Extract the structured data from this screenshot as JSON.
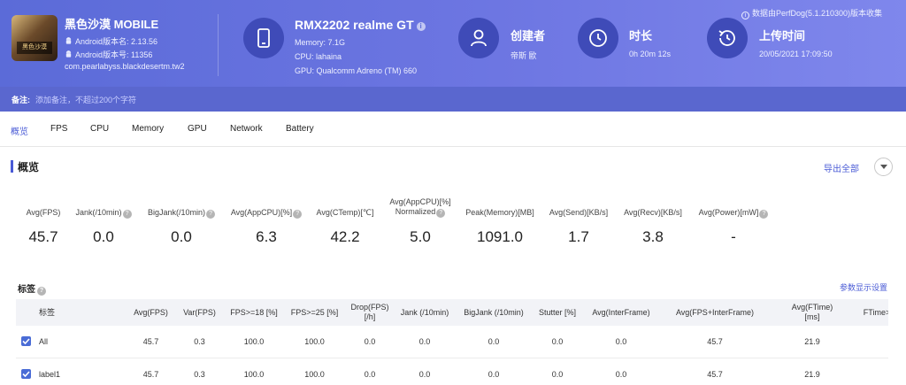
{
  "app": {
    "name": "黑色沙漠 MOBILE",
    "version_name": "Android版本名: 2.13.56",
    "version_code": "Android版本号: 11356",
    "package": "com.pearlabyss.blackdesertm.tw2",
    "icon_text": "黑色沙漠"
  },
  "device": {
    "model": "RMX2202 realme GT",
    "memory": "Memory: 7.1G",
    "cpu": "CPU: lahaina",
    "gpu": "GPU: Qualcomm Adreno (TM) 660"
  },
  "creator": {
    "title": "创建者",
    "value": "帝斯 歐"
  },
  "duration": {
    "title": "时长",
    "value": "0h 20m 12s"
  },
  "upload": {
    "title": "上传时间",
    "value": "20/05/2021 17:09:50"
  },
  "perfdog_note": "数据由PerfDog(5.1.210300)版本收集",
  "note": {
    "label": "备注:",
    "placeholder": "添加备注，不超过200个字符"
  },
  "tabs": [
    "概览",
    "FPS",
    "CPU",
    "Memory",
    "GPU",
    "Network",
    "Battery"
  ],
  "active_tab": "概览",
  "section": {
    "title": "概览",
    "export": "导出全部"
  },
  "metrics": [
    {
      "label": "Avg(FPS)",
      "label2": "",
      "value": "45.7",
      "help": false
    },
    {
      "label": "Jank(/10min)",
      "label2": "",
      "value": "0.0",
      "help": true
    },
    {
      "label": "BigJank(/10min)",
      "label2": "",
      "value": "0.0",
      "help": true
    },
    {
      "label": "Avg(AppCPU)[%]",
      "label2": "",
      "value": "6.3",
      "help": true
    },
    {
      "label": "Avg(CTemp)[℃]",
      "label2": "",
      "value": "42.2",
      "help": false
    },
    {
      "label": "Avg(AppCPU)[%]",
      "label2": "Normalized",
      "value": "5.0",
      "help": true
    },
    {
      "label": "Peak(Memory)[MB]",
      "label2": "",
      "value": "1091.0",
      "help": false
    },
    {
      "label": "Avg(Send)[KB/s]",
      "label2": "",
      "value": "1.7",
      "help": false
    },
    {
      "label": "Avg(Recv)[KB/s]",
      "label2": "",
      "value": "3.8",
      "help": false
    },
    {
      "label": "Avg(Power)[mW]",
      "label2": "",
      "value": "-",
      "help": true
    }
  ],
  "tags": {
    "title": "标签",
    "settings": "参数显示设置",
    "columns": [
      {
        "l1": "标签",
        "l2": ""
      },
      {
        "l1": "Avg(FPS)",
        "l2": ""
      },
      {
        "l1": "Var(FPS)",
        "l2": ""
      },
      {
        "l1": "FPS>=18 [%]",
        "l2": ""
      },
      {
        "l1": "FPS>=25 [%]",
        "l2": ""
      },
      {
        "l1": "Drop(FPS)",
        "l2": "[/h]"
      },
      {
        "l1": "Jank (/10min)",
        "l2": ""
      },
      {
        "l1": "BigJank (/10min)",
        "l2": ""
      },
      {
        "l1": "Stutter [%]",
        "l2": ""
      },
      {
        "l1": "Avg(InterFrame)",
        "l2": ""
      },
      {
        "l1": "Avg(FPS+InterFrame)",
        "l2": ""
      },
      {
        "l1": "Avg(FTime)",
        "l2": "[ms]"
      },
      {
        "l1": "FTime>",
        "l2": ""
      }
    ],
    "rows": [
      {
        "label": "All",
        "checked": true,
        "cells": [
          "45.7",
          "0.3",
          "100.0",
          "100.0",
          "0.0",
          "0.0",
          "0.0",
          "0.0",
          "0.0",
          "45.7",
          "21.9"
        ]
      },
      {
        "label": "label1",
        "checked": true,
        "cells": [
          "45.7",
          "0.3",
          "100.0",
          "100.0",
          "0.0",
          "0.0",
          "0.0",
          "0.0",
          "0.0",
          "45.7",
          "21.9"
        ]
      }
    ]
  },
  "colors": {
    "header": "#5b6bd8",
    "accent": "#4a5bd6",
    "note_bar": "#5a67cf"
  }
}
